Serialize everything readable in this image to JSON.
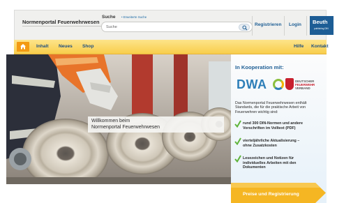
{
  "header": {
    "portal_name": "Normenportal Feuerwehrwesen",
    "search_label": "Suche",
    "advanced_search": "• Erweiterte Suche",
    "search_placeholder": "Suche",
    "register": "Registrieren",
    "login": "Login",
    "logo_name": "Beuth",
    "logo_sub": "publishing DIN"
  },
  "nav": {
    "home_icon": "home-icon",
    "items": [
      "Inhalt",
      "Neues",
      "Shop"
    ],
    "right_items": [
      "Hilfe",
      "Kontakt"
    ]
  },
  "hero": {
    "welcome_line1": "Willkommen beim",
    "welcome_line2": "Normenportal Feuerwehrwesen"
  },
  "panel": {
    "title": "In Kooperation mit:",
    "dwa_logo": "DWA",
    "dfv_logo": [
      "DEUTSCHER",
      "FEUERWEHR",
      "VERBAND"
    ],
    "intro": [
      "Das Normenportal Feuerwehrwesen enthält",
      "Standards, die für die praktische Arbeit von",
      "Feuerwehren wichtig sind:"
    ],
    "features": [
      [
        "rund 300 DIN-Normen und andere",
        "Vorschriften im Volltext (PDF)"
      ],
      [
        "vierteljährliche Aktualisierung –",
        "ohne Zusatzkosten"
      ],
      [
        "Lesezeichen und Notizen für",
        "individuelles Arbeiten mit den",
        "Dokumenten"
      ]
    ],
    "cta": "Preise und Registrierung"
  },
  "colors": {
    "nav_gradient_top": "#fde48a",
    "nav_gradient_bottom": "#f8cd4b",
    "link_blue": "#1f5f95",
    "cta_orange": "#f5b623",
    "check_green": "#5fb43a",
    "beuth_blue": "#1d5d95"
  }
}
